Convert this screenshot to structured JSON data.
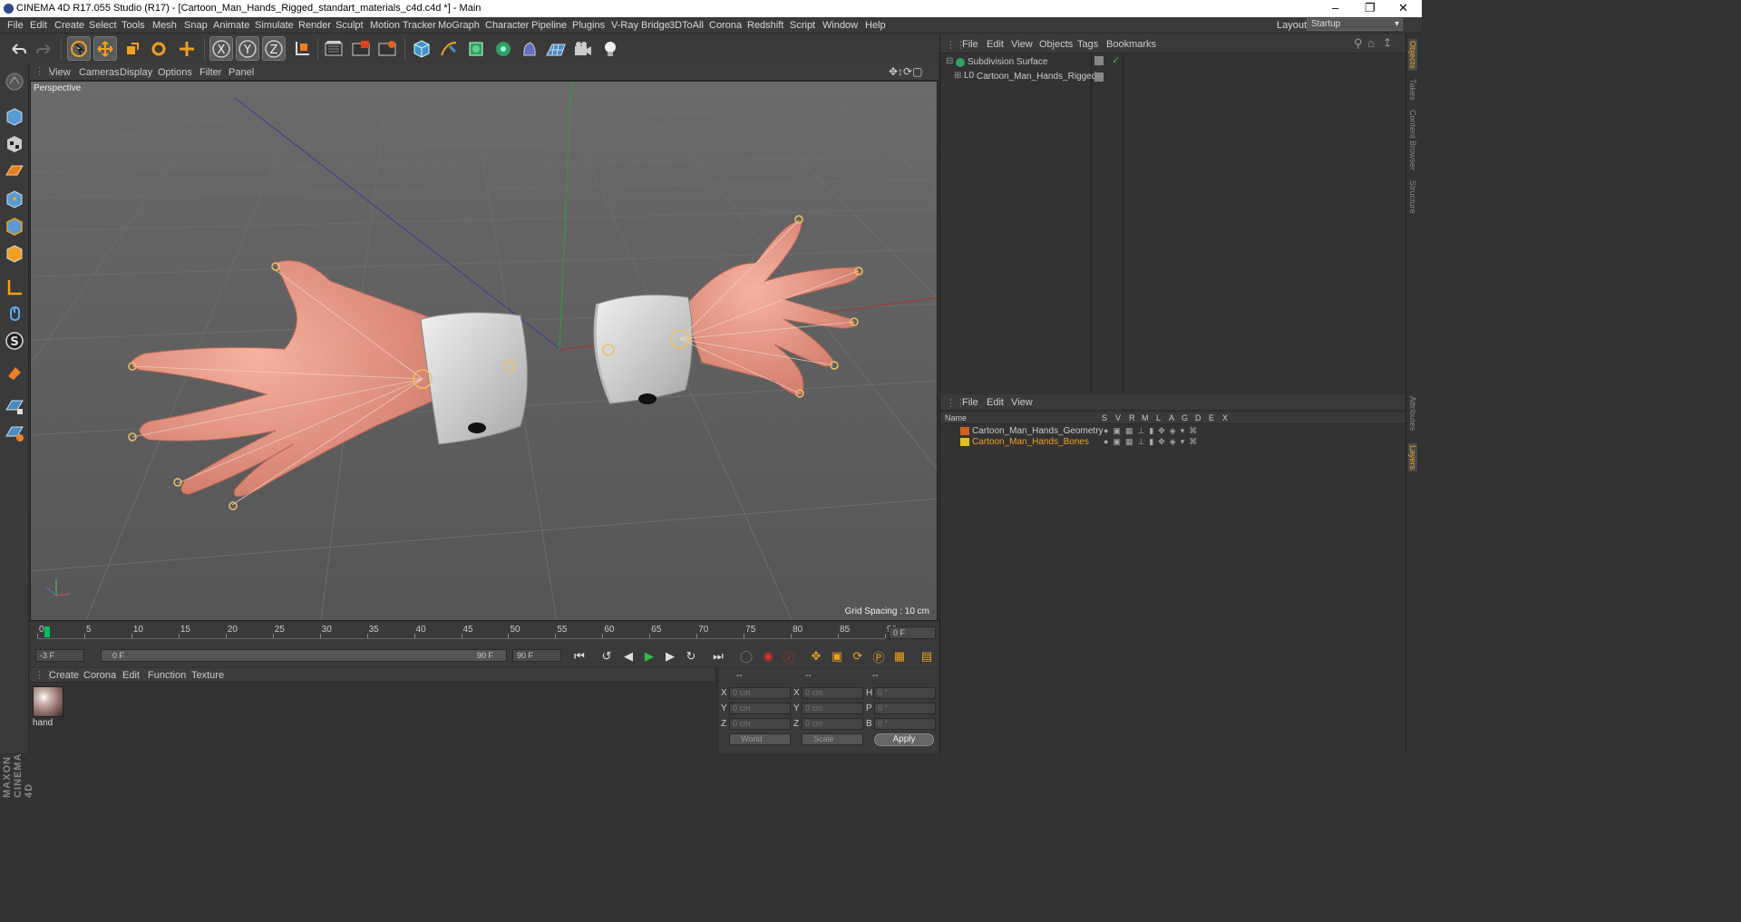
{
  "window": {
    "title": "CINEMA 4D R17.055 Studio (R17) - [Cartoon_Man_Hands_Rigged_standart_materials_c4d.c4d *] - Main"
  },
  "menu": [
    "File",
    "Edit",
    "Create",
    "Select",
    "Tools",
    "Mesh",
    "Snap",
    "Animate",
    "Simulate",
    "Render",
    "Sculpt",
    "Motion Tracker",
    "MoGraph",
    "Character",
    "Pipeline",
    "Plugins",
    "V-Ray Bridge",
    "3DToAll",
    "Corona",
    "Redshift",
    "Script",
    "Window",
    "Help"
  ],
  "layout": {
    "label": "Layout:",
    "value": "Startup"
  },
  "viewport": {
    "menu": [
      "View",
      "Cameras",
      "Display",
      "Options",
      "Filter",
      "Panel"
    ],
    "camera": "Perspective",
    "grid_spacing": "Grid Spacing : 10 cm"
  },
  "timeline": {
    "ticks": [
      "0",
      "5",
      "10",
      "15",
      "20",
      "25",
      "30",
      "35",
      "40",
      "45",
      "50",
      "55",
      "60",
      "65",
      "70",
      "75",
      "80",
      "85",
      "90"
    ],
    "current_frame": "0 F",
    "start": "-3 F",
    "range_start": "0 F",
    "range_end": "90 F",
    "end": "90 F"
  },
  "materials": {
    "menu": [
      "Create",
      "Corona",
      "Edit",
      "Function",
      "Texture"
    ],
    "items": [
      {
        "name": "hand"
      }
    ]
  },
  "coords": {
    "headers": [
      "--",
      "--",
      "--"
    ],
    "rows": [
      {
        "a": "X",
        "av": "0 cm",
        "b": "X",
        "bv": "0 cm",
        "c": "H",
        "cv": "0 °"
      },
      {
        "a": "Y",
        "av": "0 cm",
        "b": "Y",
        "bv": "0 cm",
        "c": "P",
        "cv": "0 °"
      },
      {
        "a": "Z",
        "av": "0 cm",
        "b": "Z",
        "bv": "0 cm",
        "c": "B",
        "cv": "0 °"
      }
    ],
    "mode1": "World",
    "mode2": "Scale",
    "apply": "Apply"
  },
  "objects": {
    "menu": [
      "File",
      "Edit",
      "View",
      "Objects",
      "Tags",
      "Bookmarks"
    ],
    "items": [
      "Subdivision Surface",
      "Cartoon_Man_Hands_Rigged"
    ]
  },
  "layers": {
    "menu": [
      "File",
      "Edit",
      "View"
    ],
    "name_header": "Name",
    "columns": [
      "S",
      "V",
      "R",
      "M",
      "L",
      "A",
      "G",
      "D",
      "E",
      "X"
    ],
    "items": [
      {
        "name": "Cartoon_Man_Hands_Geometry",
        "color": "#d06020"
      },
      {
        "name": "Cartoon_Man_Hands_Bones",
        "color": "#e0c020"
      }
    ]
  },
  "side_tabs": [
    "Objects",
    "Takes",
    "Content Browser",
    "Structure",
    "Attributes",
    "Layers"
  ],
  "brand": "MAXON CINEMA 4D",
  "colors": {
    "accent_orange": "#f0a020",
    "timeline_marker": "#00c060",
    "skin": "#e89080",
    "cuff": "#d8d8d8"
  }
}
